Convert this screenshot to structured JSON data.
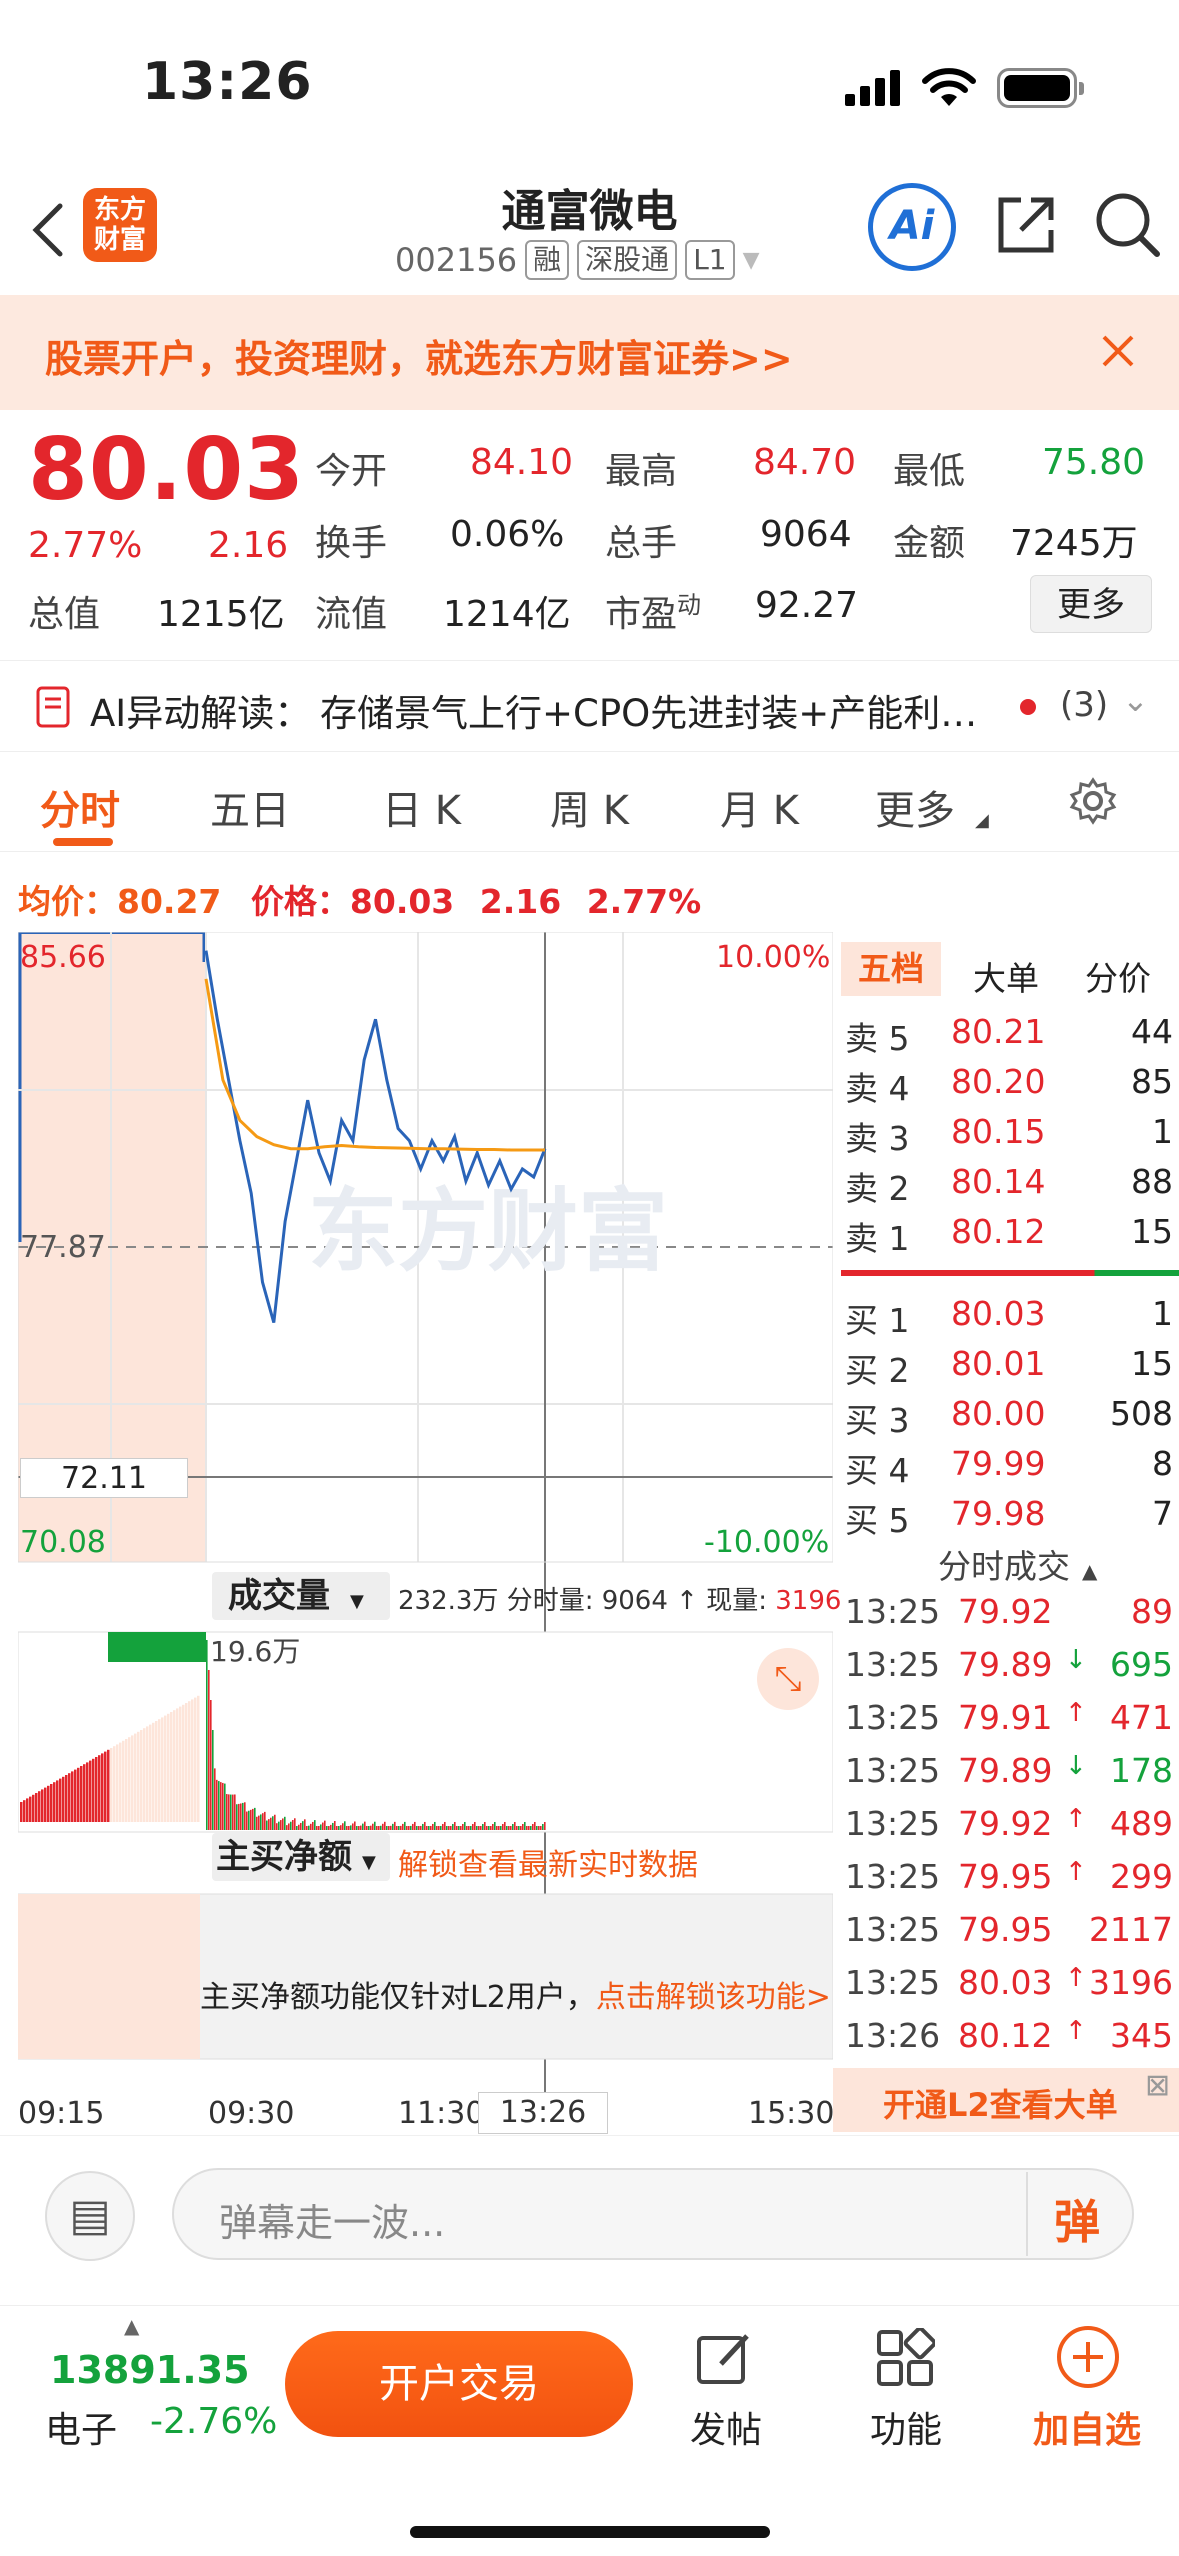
{
  "status": {
    "time": "13:26"
  },
  "header": {
    "logo_text": "东方\n财富",
    "title": "通富微电",
    "code": "002156",
    "tags": [
      "融",
      "深股通",
      "L1"
    ]
  },
  "banner": {
    "text": "股票开户，投资理财，就选东方财富证券>>"
  },
  "quote": {
    "price": "80.03",
    "change_pct": "2.77%",
    "change": "2.16",
    "open_label": "今开",
    "open": "84.10",
    "high_label": "最高",
    "high": "84.70",
    "low_label": "最低",
    "low": "75.80",
    "turnover_label": "换手",
    "turnover": "0.06%",
    "volume_label": "总手",
    "volume": "9064",
    "amount_label": "金额",
    "amount": "7245万",
    "mcap_label": "总值",
    "mcap": "1215亿",
    "float_label": "流值",
    "float": "1214亿",
    "pe_label": "市盈",
    "pe_sup": "动",
    "pe": "92.27",
    "more": "更多"
  },
  "ai": {
    "label": "AI异动解读：",
    "text": "存储景气上行+CPO先进封装+产能利…",
    "count": "(3)"
  },
  "tabs": [
    "分时",
    "五日",
    "日 K",
    "周 K",
    "月 K",
    "更多"
  ],
  "info": {
    "avg_label": "均价：",
    "avg": "80.27",
    "price_label": "价格：",
    "price": "80.03",
    "chg": "2.16",
    "pct": "2.77%"
  },
  "chart": {
    "y_high": "85.66",
    "y_mid": "77.87",
    "y_low": "70.08",
    "pct_high": "10.00%",
    "pct_low": "-10.00%",
    "cursor_price": "72.11",
    "watermark": "东方财富",
    "vol_label": "成交量",
    "vol_info1": "232.3万",
    "vol_info2": "分时量: 9064 ↑",
    "vol_info3": "现量:",
    "vol_now": "3196",
    "vol_max": "19.6万",
    "net_label": "主买净额",
    "net_link": "解锁查看最新实时数据",
    "net_msg": "主买净额功能仅针对L2用户，",
    "net_unlock": "点击解锁该功能>",
    "times": [
      "09:15",
      "09:30",
      "11:30",
      "13:26",
      "15:30"
    ]
  },
  "chart_data": {
    "type": "line",
    "ylim": [
      70.08,
      85.66
    ],
    "series": [
      {
        "values": [
          85.2,
          83.5,
          82.0,
          80.5,
          79.2,
          77.0,
          76.0,
          78.5,
          80.0,
          81.5,
          80.2,
          79.5,
          81.0,
          80.5,
          82.5,
          83.5,
          82.0,
          80.8,
          80.5,
          79.8,
          80.5,
          80.0,
          80.6,
          79.5,
          80.2,
          79.4,
          80.0,
          79.3,
          79.8,
          79.6,
          80.3
        ]
      },
      {
        "values": [
          84.5,
          82.0,
          81.0,
          80.6,
          80.4,
          80.3,
          80.3,
          80.35,
          80.38,
          80.35,
          80.33,
          80.32,
          80.31,
          80.3,
          80.3,
          80.29,
          80.28,
          80.28,
          80.27,
          80.27,
          80.27
        ]
      }
    ]
  },
  "orderbook": {
    "tabs": [
      "五档",
      "大单",
      "分价"
    ],
    "asks": [
      {
        "label": "卖 5",
        "price": "80.21",
        "vol": "44"
      },
      {
        "label": "卖 4",
        "price": "80.20",
        "vol": "85"
      },
      {
        "label": "卖 3",
        "price": "80.15",
        "vol": "1"
      },
      {
        "label": "卖 2",
        "price": "80.14",
        "vol": "88"
      },
      {
        "label": "卖 1",
        "price": "80.12",
        "vol": "15"
      }
    ],
    "bids": [
      {
        "label": "买 1",
        "price": "80.03",
        "vol": "1"
      },
      {
        "label": "买 2",
        "price": "80.01",
        "vol": "15"
      },
      {
        "label": "买 3",
        "price": "80.00",
        "vol": "508"
      },
      {
        "label": "买 4",
        "price": "79.99",
        "vol": "8"
      },
      {
        "label": "买 5",
        "price": "79.98",
        "vol": "7"
      }
    ],
    "trades_title": "分时成交",
    "trades": [
      {
        "t": "13:25",
        "p": "79.92",
        "d": "",
        "v": "89",
        "c": "red"
      },
      {
        "t": "13:25",
        "p": "79.89",
        "d": "↓",
        "v": "695",
        "c": "green"
      },
      {
        "t": "13:25",
        "p": "79.91",
        "d": "↑",
        "v": "471",
        "c": "red"
      },
      {
        "t": "13:25",
        "p": "79.89",
        "d": "↓",
        "v": "178",
        "c": "green"
      },
      {
        "t": "13:25",
        "p": "79.92",
        "d": "↑",
        "v": "489",
        "c": "red"
      },
      {
        "t": "13:25",
        "p": "79.95",
        "d": "↑",
        "v": "299",
        "c": "red"
      },
      {
        "t": "13:25",
        "p": "79.95",
        "d": "",
        "v": "2117",
        "c": "red"
      },
      {
        "t": "13:25",
        "p": "80.03",
        "d": "↑",
        "v": "3196",
        "c": "red"
      },
      {
        "t": "13:26",
        "p": "80.12",
        "d": "↑",
        "v": "345",
        "c": "red"
      }
    ],
    "l2": "开通L2查看大单"
  },
  "comment": {
    "placeholder": "弹幕走一波...",
    "btn": "弹"
  },
  "footer": {
    "index_value": "13891.35",
    "index_name": "电子",
    "index_pct": "-2.76%",
    "trade_btn": "开户交易",
    "post": "发帖",
    "func": "功能",
    "add": "加自选"
  }
}
